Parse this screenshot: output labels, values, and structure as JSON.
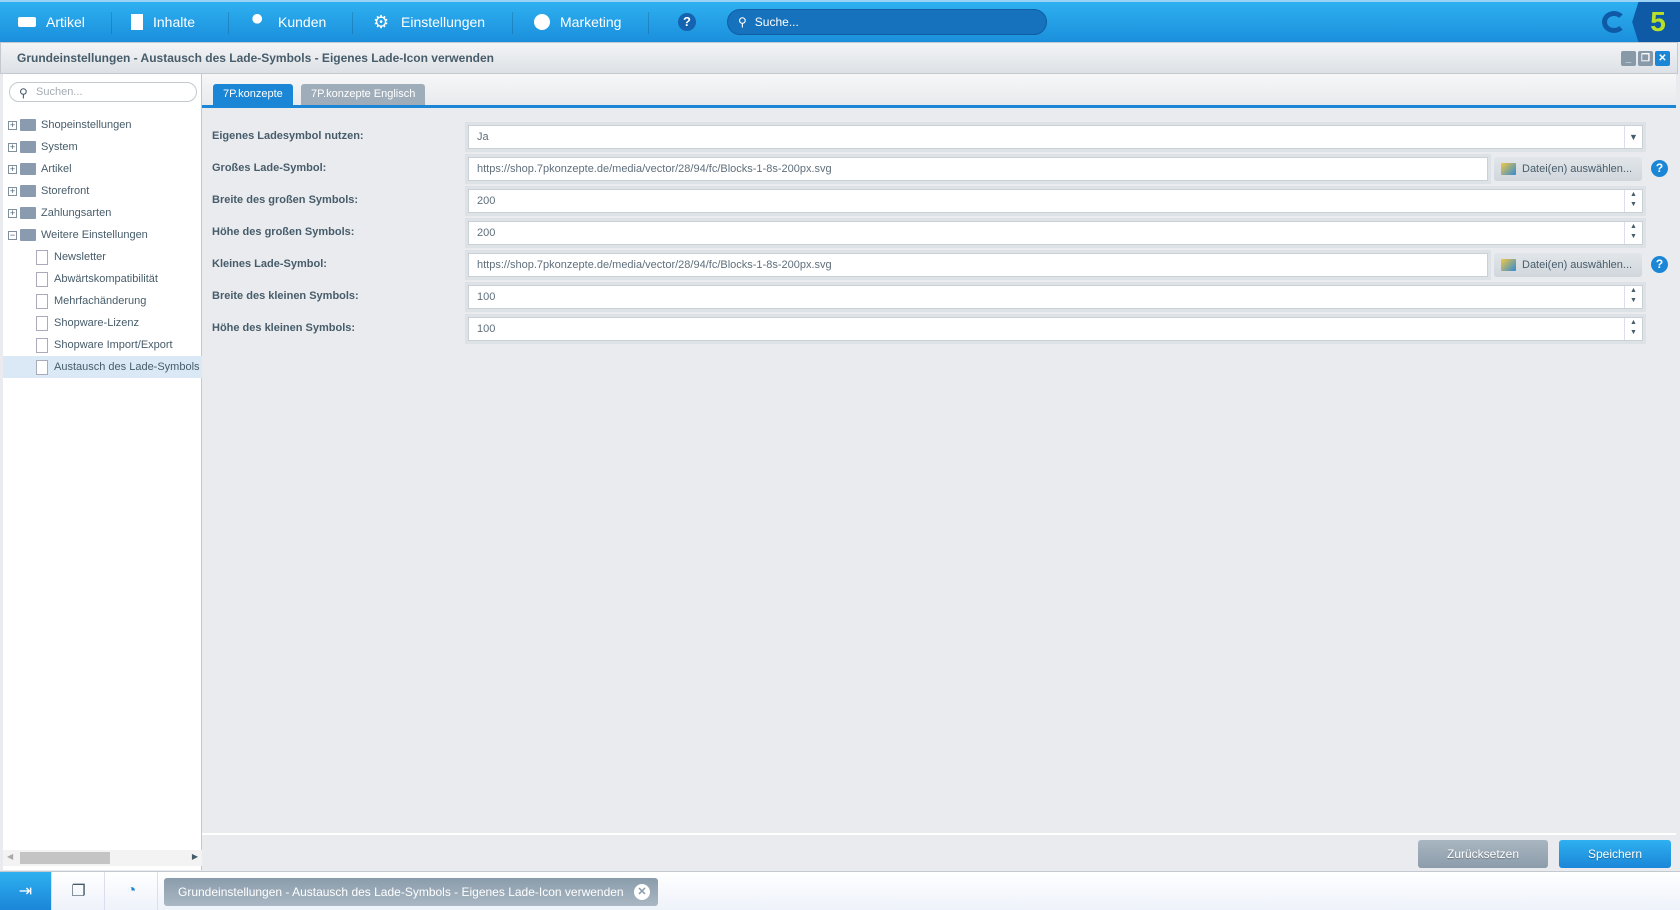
{
  "topnav": {
    "items": [
      {
        "label": "Artikel",
        "icon": "inbox-icon"
      },
      {
        "label": "Inhalte",
        "icon": "document-icon"
      },
      {
        "label": "Kunden",
        "icon": "users-icon"
      },
      {
        "label": "Einstellungen",
        "icon": "gear-icon"
      },
      {
        "label": "Marketing",
        "icon": "pie-chart-icon"
      }
    ],
    "help": "?",
    "search_placeholder": "Suche...",
    "logo": "5"
  },
  "window": {
    "title": "Grundeinstellungen - Austausch des Lade-Symbols - Eigenes Lade-Icon verwenden"
  },
  "sidebar": {
    "search_placeholder": "Suchen...",
    "tree": [
      {
        "label": "Shopeinstellungen",
        "type": "folder",
        "expanded": false
      },
      {
        "label": "System",
        "type": "folder",
        "expanded": false
      },
      {
        "label": "Artikel",
        "type": "folder",
        "expanded": false
      },
      {
        "label": "Storefront",
        "type": "folder",
        "expanded": false
      },
      {
        "label": "Zahlungsarten",
        "type": "folder",
        "expanded": false
      },
      {
        "label": "Weitere Einstellungen",
        "type": "folder",
        "expanded": true
      },
      {
        "label": "Newsletter",
        "type": "leaf"
      },
      {
        "label": "Abwärtskompatibilität",
        "type": "leaf"
      },
      {
        "label": "Mehrfachänderung",
        "type": "leaf"
      },
      {
        "label": "Shopware-Lizenz",
        "type": "leaf"
      },
      {
        "label": "Shopware Import/Export",
        "type": "leaf"
      },
      {
        "label": "Austausch des Lade-Symbols",
        "type": "leaf",
        "selected": true
      }
    ]
  },
  "tabs": [
    {
      "label": "7P.konzepte",
      "active": true
    },
    {
      "label": "7P.konzepte Englisch",
      "active": false
    }
  ],
  "form": {
    "file_button": "Datei(en) auswählen...",
    "help": "?",
    "fields": [
      {
        "label": "Eigenes Ladesymbol nutzen:",
        "value": "Ja",
        "type": "select"
      },
      {
        "label": "Großes Lade-Symbol:",
        "value": "https://shop.7pkonzepte.de/media/vector/28/94/fc/Blocks-1-8s-200px.svg",
        "type": "file"
      },
      {
        "label": "Breite des großen Symbols:",
        "value": "200",
        "type": "number"
      },
      {
        "label": "Höhe des großen Symbols:",
        "value": "200",
        "type": "number"
      },
      {
        "label": "Kleines Lade-Symbol:",
        "value": "https://shop.7pkonzepte.de/media/vector/28/94/fc/Blocks-1-8s-200px.svg",
        "type": "file"
      },
      {
        "label": "Breite des kleinen Symbols:",
        "value": "100",
        "type": "number"
      },
      {
        "label": "Höhe des kleinen Symbols:",
        "value": "100",
        "type": "number"
      }
    ]
  },
  "actions": {
    "reset": "Zurücksetzen",
    "save": "Speichern"
  },
  "taskbar": {
    "item": "Grundeinstellungen - Austausch des Lade-Symbols - Eigenes Lade-Icon verwenden"
  },
  "colors": {
    "accent": "#1c86d6",
    "logo": "#b8e02a"
  }
}
